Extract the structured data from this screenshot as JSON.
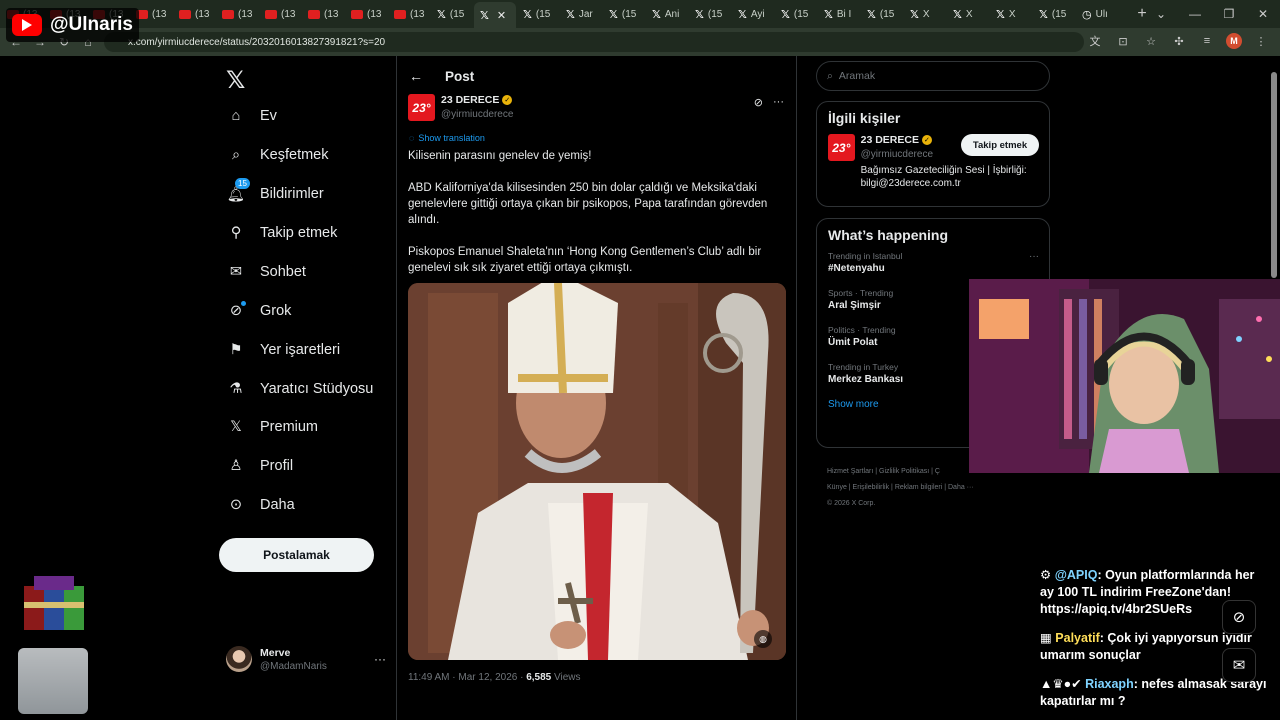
{
  "browser": {
    "tabs": [
      {
        "label": "(13",
        "type": "yt"
      },
      {
        "label": "(13",
        "type": "yt"
      },
      {
        "label": "(13",
        "type": "yt"
      },
      {
        "label": "(13",
        "type": "yt"
      },
      {
        "label": "(13",
        "type": "yt"
      },
      {
        "label": "(13",
        "type": "yt"
      },
      {
        "label": "(13",
        "type": "yt"
      },
      {
        "label": "(13",
        "type": "yt"
      },
      {
        "label": "(13",
        "type": "yt"
      },
      {
        "label": "(13",
        "type": "yt"
      },
      {
        "label": "(15",
        "type": "x"
      },
      {
        "label": "",
        "type": "x",
        "active": true
      },
      {
        "label": "(15",
        "type": "x"
      },
      {
        "label": "Jar",
        "type": "x"
      },
      {
        "label": "(15",
        "type": "x"
      },
      {
        "label": "Ani",
        "type": "x"
      },
      {
        "label": "(15",
        "type": "x"
      },
      {
        "label": "Ayi",
        "type": "x"
      },
      {
        "label": "(15",
        "type": "x"
      },
      {
        "label": "Bi I",
        "type": "x"
      },
      {
        "label": "(15",
        "type": "x"
      },
      {
        "label": "X",
        "type": "x"
      },
      {
        "label": "X",
        "type": "x"
      },
      {
        "label": "X",
        "type": "x"
      },
      {
        "label": "(15",
        "type": "x"
      },
      {
        "label": "Ulı",
        "type": "other"
      }
    ],
    "url": "x.com/yirmiucderece/status/2032016013827391821?s=20"
  },
  "overlay": {
    "channel": "@Ulnaris"
  },
  "nav": {
    "items": [
      {
        "label": "Ev",
        "icon": "home-icon"
      },
      {
        "label": "Keşfetmek",
        "icon": "search-icon"
      },
      {
        "label": "Bildirimler",
        "icon": "bell-icon",
        "badge": "15"
      },
      {
        "label": "Takip etmek",
        "icon": "add-person-icon"
      },
      {
        "label": "Sohbet",
        "icon": "envelope-icon"
      },
      {
        "label": "Grok",
        "icon": "grok-icon"
      },
      {
        "label": "Yer işaretleri",
        "icon": "bookmark-icon"
      },
      {
        "label": "Yaratıcı Stüdyosu",
        "icon": "flask-icon"
      },
      {
        "label": "Premium",
        "icon": "x-icon"
      },
      {
        "label": "Profil",
        "icon": "person-icon"
      },
      {
        "label": "Daha",
        "icon": "more-circle-icon"
      }
    ],
    "post_button": "Postalamak",
    "user": {
      "name": "Merve",
      "handle": "@MadamNaris"
    }
  },
  "post": {
    "header": "Post",
    "author_name": "23 DERECE",
    "author_handle": "@yirmiucderece",
    "logo_text": "23°",
    "translate": "Show translation",
    "text1": "Kilisenin parasını genelev de yemiş!",
    "text2": "ABD Kaliforniya'da kilisesinden 250 bin dolar çaldığı ve Meksika'daki genelevlere gittiği ortaya çıkan bir psikopos, Papa tarafından görevden alındı.",
    "text3": "Piskopos Emanuel Shaleta'nın ‘Hong Kong Gentlemen’s Club’ adlı bir genelevi sık sık ziyaret ettiği ortaya çıkmıştı.",
    "time": "11:49 AM · Mar 12, 2026 · ",
    "views": "6,585",
    "views_label": " Views"
  },
  "right": {
    "search_placeholder": "Aramak",
    "related_title": "İlgili kişiler",
    "related_name": "23 DERECE",
    "related_handle": "@yirmiucderece",
    "follow": "Takip etmek",
    "bio": "Bağımsız Gazeteciliğin Sesi | İşbirliği: bilgi@23derece.com.tr",
    "happening_title": "What’s happening",
    "trends": [
      {
        "meta": "Trending in Istanbul",
        "name": "#Netenyahu"
      },
      {
        "meta": "Sports · Trending",
        "name": "Aral Şimşir"
      },
      {
        "meta": "Politics · Trending",
        "name": "Ümit Polat"
      },
      {
        "meta": "Trending in Turkey",
        "name": "Merkez Bankası"
      }
    ],
    "show_more": "Show more",
    "footer1": "Hizmet Şartları  |  Gizlilik Politikası  |  Ç",
    "footer2": "Künye  |  Erişilebilirlik  |  Reklam bilgileri  |  Daha ···",
    "footer3": "© 2026 X Corp."
  },
  "chat": [
    {
      "nick": "@APIQ",
      "text": ": Oyun platformlarında her ay 100 TL indirim FreeZone'dan! https://apiq.tv/4br2SUeRs"
    },
    {
      "nick": "Palyatif",
      "text": ": Çok iyi yapıyorsun iyidir umarım sonuçlar"
    },
    {
      "nick": "Riaxaph",
      "text": ": nefes almasak sarayı kapatırlar mı ?"
    }
  ],
  "colors": {
    "accent": "#1d9bf0",
    "verified": "#e9b30a",
    "brand_red": "#e4181f"
  }
}
